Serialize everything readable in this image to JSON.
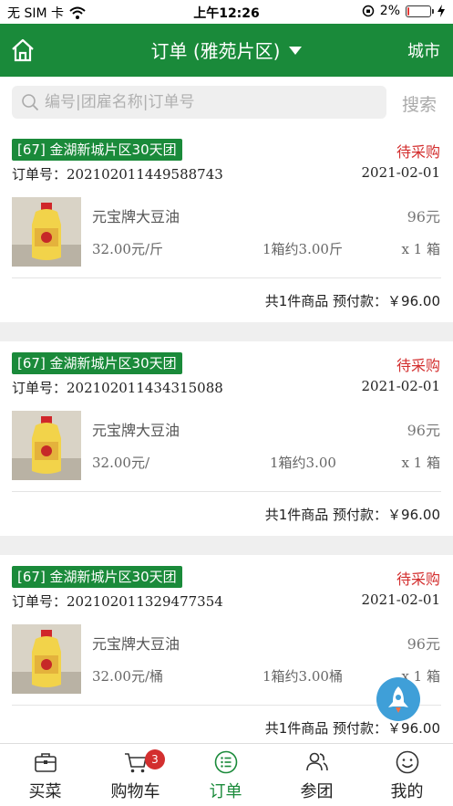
{
  "status_bar": {
    "carrier": "无 SIM 卡",
    "time": "上午12:26",
    "battery": "2%",
    "battery_level": 0.02,
    "icons": [
      "wifi-icon",
      "orientation-lock-icon",
      "battery-icon",
      "charging-icon"
    ]
  },
  "navbar": {
    "title": "订单 (雅苑片区)",
    "right_action": "城市",
    "home_icon": "home-icon",
    "dropdown_icon": "caret-down-icon"
  },
  "search": {
    "placeholder": "编号|团雇名称|订单号",
    "button": "搜索"
  },
  "orders": [
    {
      "tag": "[67] 金湖新城片区30天团",
      "status": "待采购",
      "order_no": "订单号：202102011449588743",
      "date": "2021-02-01",
      "product_name": "元宝牌大豆油",
      "price": "96元",
      "unit_price": "32.00元/斤",
      "pack": "1箱约3.00斤",
      "qty": "x 1 箱",
      "summary": "共1件商品 预付款：￥96.00"
    },
    {
      "tag": "[67] 金湖新城片区30天团",
      "status": "待采购",
      "order_no": "订单号：202102011434315088",
      "date": "2021-02-01",
      "product_name": "元宝牌大豆油",
      "price": "96元",
      "unit_price": "32.00元/",
      "pack": "1箱约3.00",
      "qty": "x 1 箱",
      "summary": "共1件商品 预付款：￥96.00"
    },
    {
      "tag": "[67] 金湖新城片区30天团",
      "status": "待采购",
      "order_no": "订单号：202102011329477354",
      "date": "2021-02-01",
      "product_name": "元宝牌大豆油",
      "price": "96元",
      "unit_price": "32.00元/桶",
      "pack": "1箱约3.00桶",
      "qty": "x 1 箱",
      "summary": "共1件商品 预付款：￥96.00"
    }
  ],
  "tabbar": {
    "items": [
      {
        "label": "买菜",
        "icon": "briefcase-icon"
      },
      {
        "label": "购物车",
        "icon": "cart-icon",
        "badge": "3"
      },
      {
        "label": "订单",
        "icon": "list-icon"
      },
      {
        "label": "参团",
        "icon": "group-icon"
      },
      {
        "label": "我的",
        "icon": "smiley-icon"
      }
    ]
  },
  "colors": {
    "brand_green": "#1a8a3a",
    "status_red": "#d32f2f",
    "fab_blue": "#3f9fd8"
  }
}
